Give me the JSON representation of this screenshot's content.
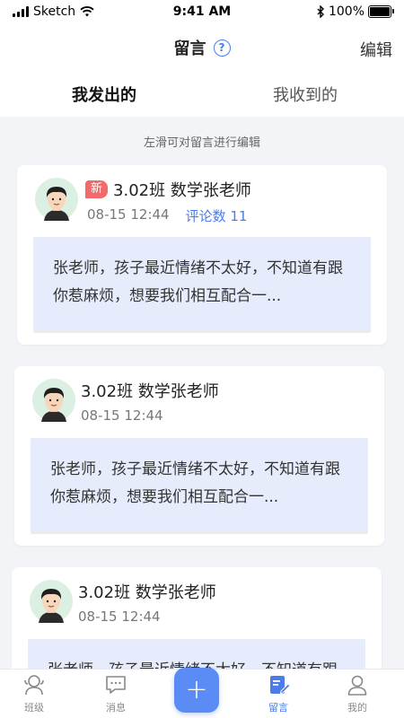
{
  "status_bar": {
    "carrier": "Sketch",
    "time": "9:41 AM",
    "battery": "100%"
  },
  "nav": {
    "title": "留言",
    "help_symbol": "?",
    "edit_label": "编辑"
  },
  "tabs": [
    {
      "label": "我发出的",
      "active": true
    },
    {
      "label": "我收到的",
      "active": false
    }
  ],
  "hint": "左滑可对留言进行编辑",
  "messages": [
    {
      "badge": "新",
      "title": "3.02班  数学张老师",
      "time": "08-15 12:44",
      "comments": "评论数 11",
      "content": "张老师，孩子最近情绪不太好，不知道有跟你惹麻烦，想要我们相互配合一..."
    },
    {
      "title": "3.02班  数学张老师",
      "time": "08-15 12:44",
      "content": "张老师，孩子最近情绪不太好，不知道有跟你惹麻烦，想要我们相互配合一..."
    },
    {
      "title": "3.02班  数学张老师",
      "time": "08-15 12:44",
      "content": "张老师，孩子最近情绪不太好，不知道有跟你惹麻烦，想要我们相互配合一..."
    }
  ],
  "tab_bar": {
    "items": [
      {
        "label": "班级",
        "icon": "class-icon"
      },
      {
        "label": "消息",
        "icon": "message-icon"
      },
      {
        "label": "留言",
        "icon": "note-edit-icon",
        "active": true
      },
      {
        "label": "我的",
        "icon": "user-icon"
      }
    ],
    "fab_symbol": "+"
  },
  "colors": {
    "accent": "#4a7de8",
    "badge": "#f26b6b",
    "bubble": "#e6ecfb",
    "background": "#f2f4f8"
  }
}
